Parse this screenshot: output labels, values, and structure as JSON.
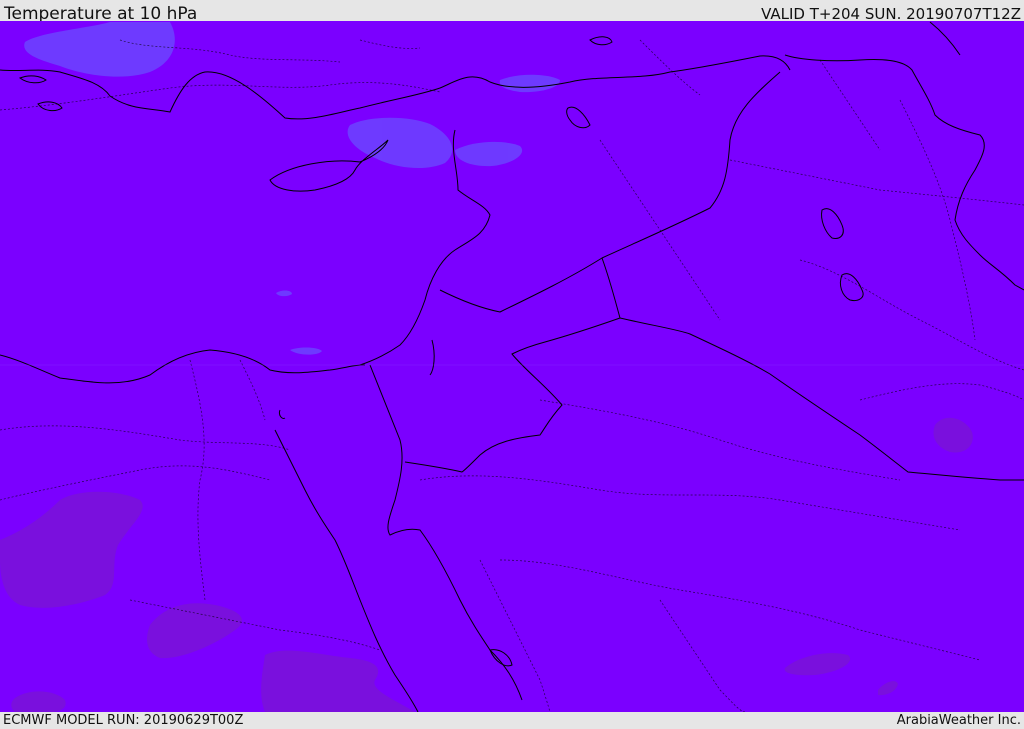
{
  "header": {
    "title": "Temperature at 10 hPa",
    "valid": "VALID T+204 SUN. 20190707T12Z"
  },
  "footer": {
    "model_run": "ECMWF MODEL RUN: 20190629T00Z",
    "credit": "ArabiaWeather Inc."
  },
  "map": {
    "field_color": "#7b00ff",
    "cooler_patch_color": "#6a4dff",
    "warmer_patch_color": "#7a10dd",
    "border_color": "#000000"
  }
}
